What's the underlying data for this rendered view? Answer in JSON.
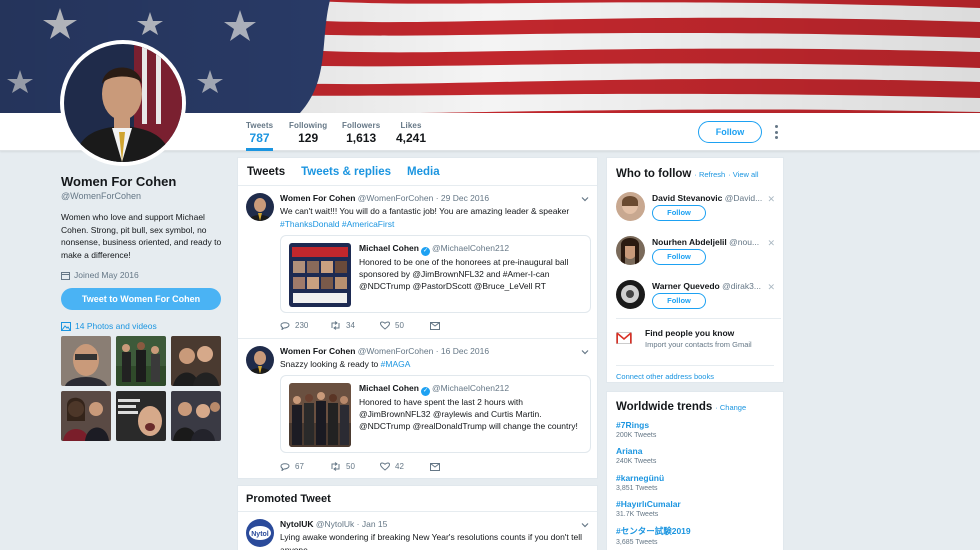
{
  "profile": {
    "name": "Women For Cohen",
    "handle": "@WomenForCohen",
    "bio": "Women who love and support Michael Cohen. Strong, pit bull, sex symbol, no nonsense, business oriented, and ready to make a difference!",
    "joined": "Joined May 2016",
    "tweet_to_label": "Tweet to Women For Cohen",
    "photos_label": "14 Photos and videos"
  },
  "stats": {
    "tweets_label": "Tweets",
    "tweets_value": "787",
    "following_label": "Following",
    "following_value": "129",
    "followers_label": "Followers",
    "followers_value": "1,613",
    "likes_label": "Likes",
    "likes_value": "4,241",
    "follow_label": "Follow"
  },
  "tabs": [
    "Tweets",
    "Tweets & replies",
    "Media"
  ],
  "tweets": [
    {
      "name": "Women For Cohen",
      "meta": "@WomenForCohen · 29 Dec 2016",
      "text_plain": "We can't wait!!! You will do a fantastic job! You are amazing leader & speaker ",
      "text_tags": "#ThanksDonald #AmericaFirst",
      "quote_name": "Michael Cohen",
      "quote_handle": "@MichaelCohen212",
      "quote_text": "Honored to be one of the honorees at pre-inaugural ball sponsored by @JimBrownNFL32 and #Amer-I-can @NDCTrump @PastorDScott @Bruce_LeVell RT",
      "replies": "230",
      "retweets": "34",
      "likes": "50"
    },
    {
      "name": "Women For Cohen",
      "meta": "@WomenForCohen · 16 Dec 2016",
      "text_plain": "Snazzy looking & ready to ",
      "text_tags": "#MAGA",
      "quote_name": "Michael Cohen",
      "quote_handle": "@MichaelCohen212",
      "quote_text": "Honored to have spent the last 2 hours with @JimBrownNFL32 @raylewis and Curtis Martin. @NDCTrump @realDonaldTrump will change the country!",
      "replies": "67",
      "retweets": "50",
      "likes": "42"
    }
  ],
  "promoted": {
    "title": "Promoted Tweet",
    "name": "NytolUK",
    "meta": "@NytolUk · Jan 15",
    "text": "Lying awake wondering if breaking New Year's resolutions counts if you don't tell anyone.",
    "logo_text": "Nytol"
  },
  "who_to_follow": {
    "title": "Who to follow",
    "refresh": "· Refresh",
    "view_all": "· View all",
    "follow_label": "Follow",
    "users": [
      {
        "name": "David Stevanovic",
        "handle": "@David..."
      },
      {
        "name": "Nourhen Abdeljelil",
        "handle": "@nou..."
      },
      {
        "name": "Warner Quevedo",
        "handle": "@dirak3..."
      }
    ],
    "find_title": "Find people you know",
    "find_sub": "Import your contacts from Gmail",
    "connect": "Connect other address books"
  },
  "trends": {
    "title": "Worldwide trends",
    "change": "· Change",
    "items": [
      {
        "name": "#7Rings",
        "count": "200K Tweets"
      },
      {
        "name": "Ariana",
        "count": "240K Tweets"
      },
      {
        "name": "#karnegünü",
        "count": "3,851 Tweets"
      },
      {
        "name": "#HayırlıCumalar",
        "count": "31.7K Tweets"
      },
      {
        "name": "#センター試験2019",
        "count": "3,685 Tweets"
      }
    ]
  },
  "colors": {
    "accent": "#1da1f2",
    "link": "#1b95e0",
    "background": "#e6ecf0"
  }
}
